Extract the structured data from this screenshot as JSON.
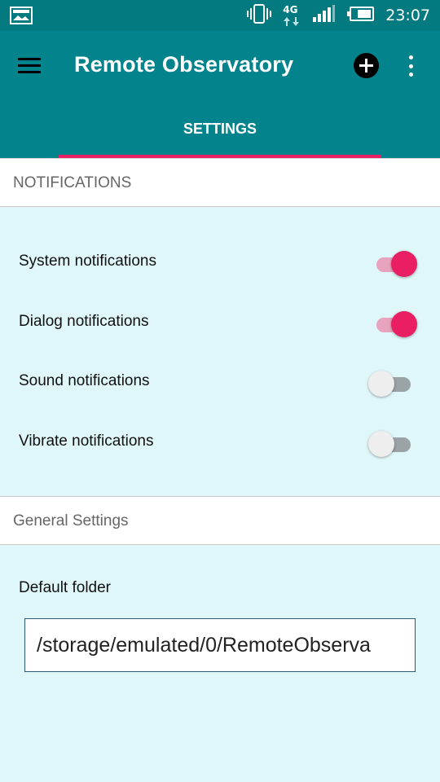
{
  "status_bar": {
    "time": "23:07",
    "network_label": "4G",
    "icons": [
      "image-notification-icon",
      "vibrate-icon",
      "network-4g-icon",
      "signal-icon",
      "battery-icon"
    ]
  },
  "app_bar": {
    "title": "Remote Observatory",
    "menu_icon": "hamburger-menu-icon",
    "add_icon": "add-circle-icon",
    "overflow_icon": "more-vert-icon"
  },
  "tabs": [
    {
      "label": "SETTINGS",
      "selected": true
    }
  ],
  "notifications_section": {
    "header": "NOTIFICATIONS",
    "items": [
      {
        "label": "System notifications",
        "enabled": true
      },
      {
        "label": "Dialog notifications",
        "enabled": true
      },
      {
        "label": "Sound notifications",
        "enabled": false
      },
      {
        "label": "Vibrate notifications",
        "enabled": false
      }
    ]
  },
  "general_section": {
    "header": "General Settings",
    "default_folder_label": "Default folder",
    "default_folder_value": "/storage/emulated/0/RemoteObserva"
  },
  "colors": {
    "status_bar": "#027a80",
    "app_bar": "#03838b",
    "accent": "#e91e63",
    "background": "#e0f7fa"
  }
}
